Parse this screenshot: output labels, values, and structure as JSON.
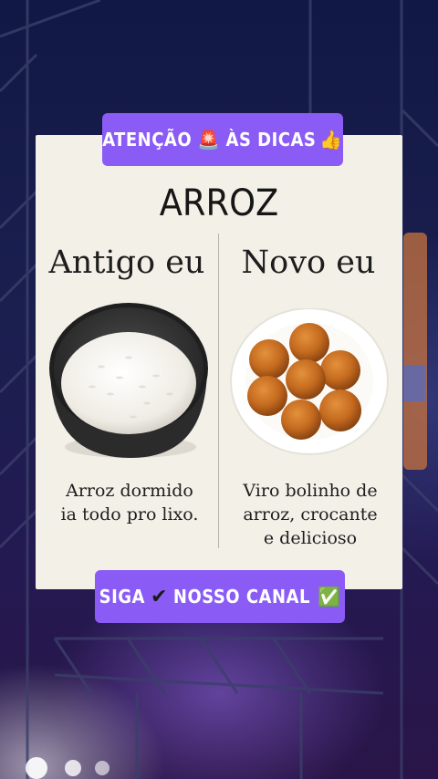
{
  "top_banner": {
    "text_a": "ATENÇÃO",
    "text_b": "ÀS DICAS",
    "siren": "🚨",
    "thumbs": "👍"
  },
  "card": {
    "title": "ARROZ",
    "left": {
      "heading": "Antigo eu",
      "caption_line1": "Arroz dormido",
      "caption_line2": "ia todo pro lixo."
    },
    "right": {
      "heading": "Novo eu",
      "caption_line1": "Viro bolinho de",
      "caption_line2": "arroz, crocante",
      "caption_line3": "e delicioso"
    }
  },
  "bottom_banner": {
    "text_a": "SIGA",
    "check1": "✔",
    "text_b": "NOSSO CANAL",
    "check2": "✅"
  },
  "colors": {
    "banner": "#8a5cf5",
    "card": "#f3f0e8",
    "background": "#121845"
  }
}
